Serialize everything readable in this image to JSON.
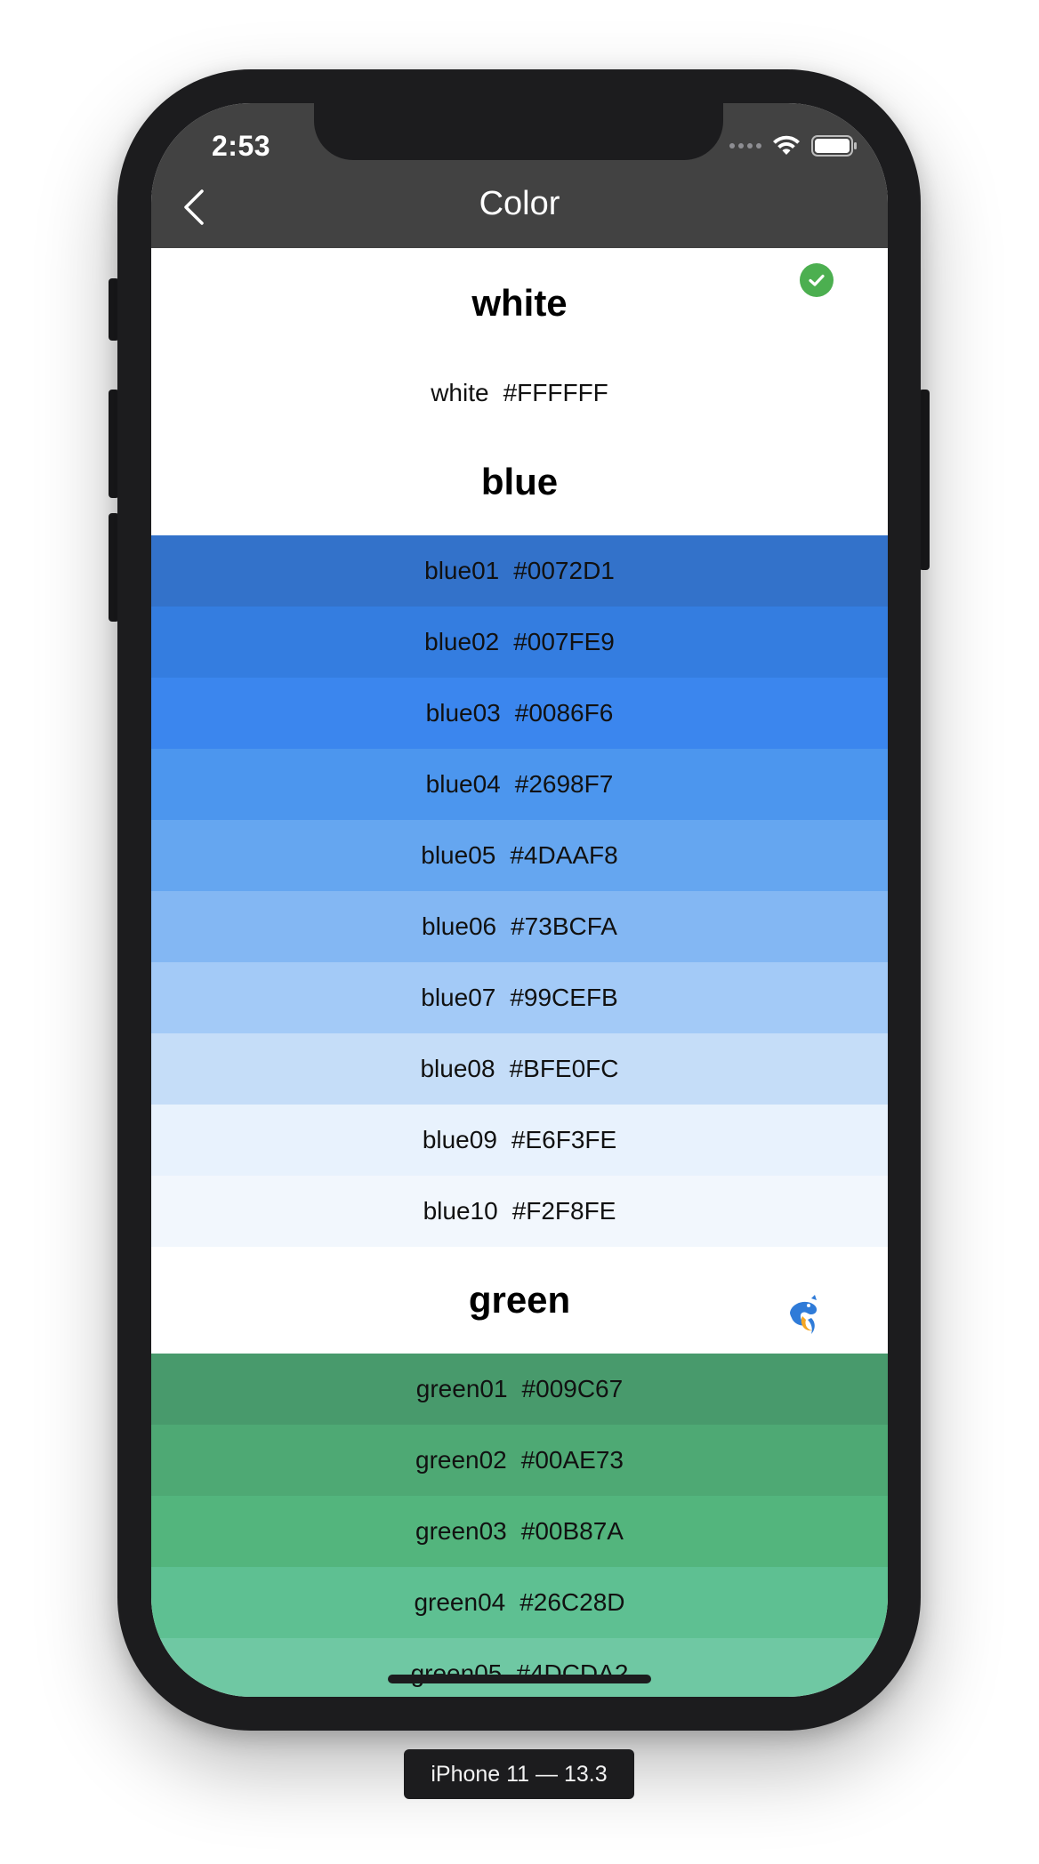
{
  "status_bar": {
    "time": "2:53"
  },
  "nav": {
    "title": "Color"
  },
  "sections": [
    {
      "title": "white",
      "rows": [
        {
          "name": "white",
          "hex": "#FFFFFF",
          "bg": "#FFFFFF"
        }
      ]
    },
    {
      "title": "blue",
      "rows": [
        {
          "name": "blue01",
          "hex": "#0072D1",
          "bg": "#3372CA"
        },
        {
          "name": "blue02",
          "hex": "#007FE9",
          "bg": "#347DE0"
        },
        {
          "name": "blue03",
          "hex": "#0086F6",
          "bg": "#3B86EE"
        },
        {
          "name": "blue04",
          "hex": "#2698F7",
          "bg": "#4C96EE"
        },
        {
          "name": "blue05",
          "hex": "#4DAAF8",
          "bg": "#65A6F0"
        },
        {
          "name": "blue06",
          "hex": "#73BCFA",
          "bg": "#83B7F3"
        },
        {
          "name": "blue07",
          "hex": "#99CEFB",
          "bg": "#A3CAF7"
        },
        {
          "name": "blue08",
          "hex": "#BFE0FC",
          "bg": "#C5DDF8"
        },
        {
          "name": "blue09",
          "hex": "#E6F3FE",
          "bg": "#E8F2FD"
        },
        {
          "name": "blue10",
          "hex": "#F2F8FE",
          "bg": "#F2F7FD"
        }
      ]
    },
    {
      "title": "green",
      "rows": [
        {
          "name": "green01",
          "hex": "#009C67",
          "bg": "#489A6C"
        },
        {
          "name": "green02",
          "hex": "#00AE73",
          "bg": "#4EA974"
        },
        {
          "name": "green03",
          "hex": "#00B87A",
          "bg": "#53B57D"
        },
        {
          "name": "green04",
          "hex": "#26C28D",
          "bg": "#5EC092"
        },
        {
          "name": "green05",
          "hex": "#4DCDA2",
          "bg": "#6FC8A3"
        }
      ]
    }
  ],
  "device_label": "iPhone 11 — 13.3",
  "icons": {
    "back": "chevron-left-icon",
    "selected": "check-circle-icon",
    "floating": "dolphin-icon"
  },
  "colors": {
    "nav_bg": "#424242",
    "check_green": "#4CAF50"
  }
}
